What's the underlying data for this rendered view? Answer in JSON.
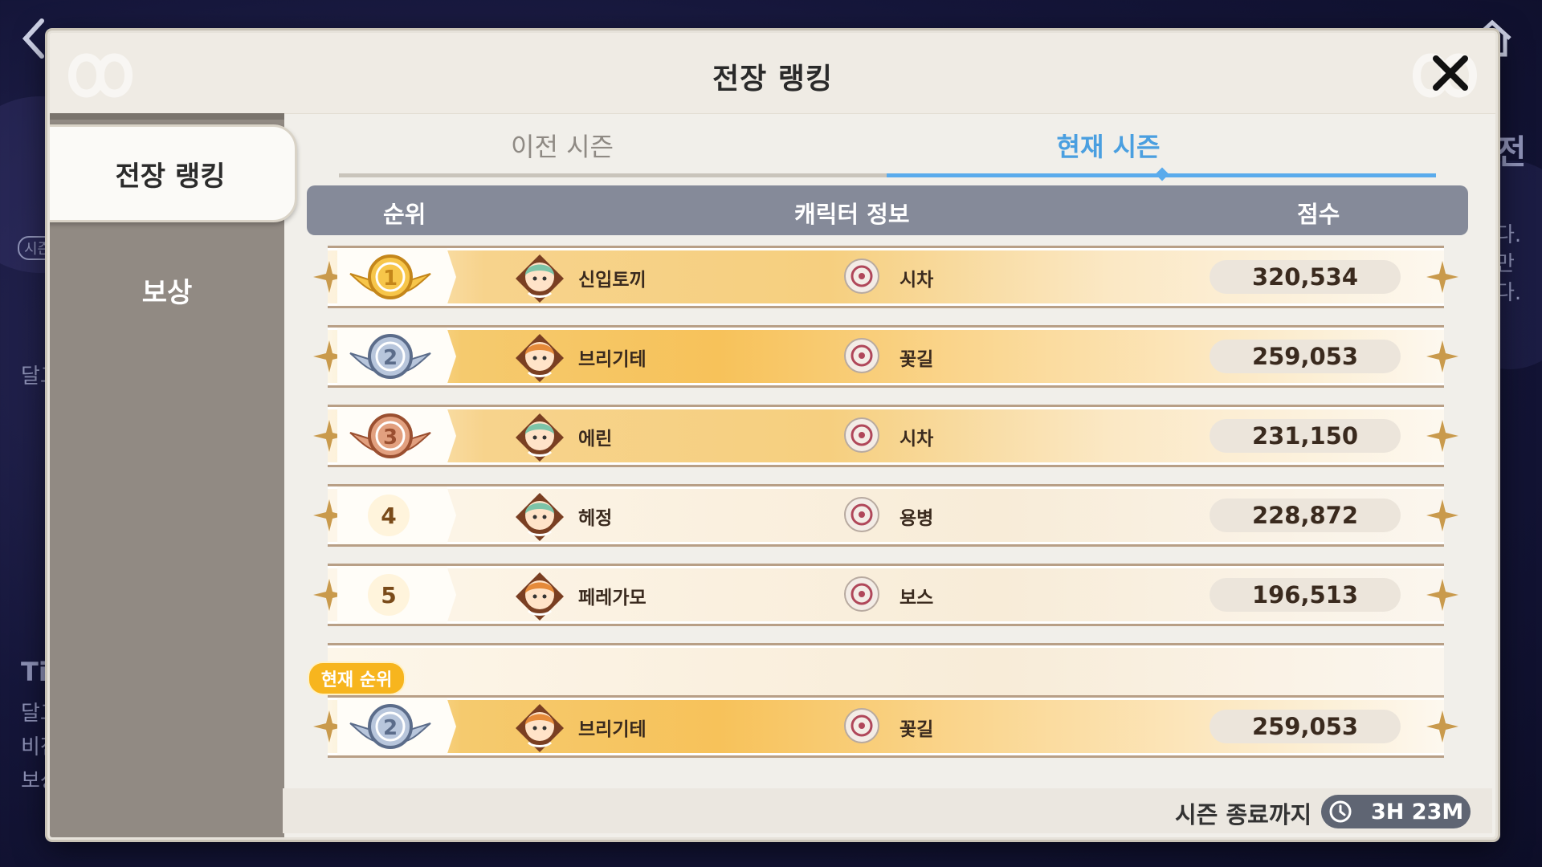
{
  "background": {
    "left_texts": [
      "시즌",
      "달그",
      "Tip",
      "달그",
      "비전",
      "보상"
    ],
    "right_texts": [
      "전",
      "다.",
      "만",
      "다."
    ]
  },
  "modal": {
    "title": "전장 랭킹",
    "close_icon": "close-icon"
  },
  "sidebar": {
    "items": [
      {
        "label": "전장 랭킹",
        "selected": true
      },
      {
        "label": "보상",
        "selected": false
      }
    ]
  },
  "tabs": [
    {
      "label": "이전 시즌",
      "active": false
    },
    {
      "label": "현재 시즌",
      "active": true
    }
  ],
  "table": {
    "headers": {
      "rank": "순위",
      "character": "캐릭터 정보",
      "score": "점수"
    },
    "rows": [
      {
        "rank": "1",
        "name": "신입토끼",
        "class": "시차",
        "score": "320,534",
        "medal": "gold",
        "avatar": "green-hair"
      },
      {
        "rank": "2",
        "name": "브리기테",
        "class": "꽃길",
        "score": "259,053",
        "medal": "silver",
        "avatar": "orange-hair"
      },
      {
        "rank": "3",
        "name": "에린",
        "class": "시차",
        "score": "231,150",
        "medal": "bronze",
        "avatar": "green-hair"
      },
      {
        "rank": "4",
        "name": "헤정",
        "class": "용병",
        "score": "228,872",
        "medal": "none",
        "avatar": "green-hair"
      },
      {
        "rank": "5",
        "name": "페레가모",
        "class": "보스",
        "score": "196,513",
        "medal": "none",
        "avatar": "orange-hair"
      }
    ]
  },
  "current_rank": {
    "badge": "현재 순위",
    "rank": "2",
    "name": "브리기테",
    "class": "꽃길",
    "score": "259,053"
  },
  "footer": {
    "season_end_label": "시즌 종료까지",
    "timer": "3H 23M"
  },
  "colors": {
    "accent_blue": "#5aabec",
    "header_gray": "#858a99",
    "sidebar_gray": "#918a83",
    "badge_orange": "#f7b51e"
  }
}
